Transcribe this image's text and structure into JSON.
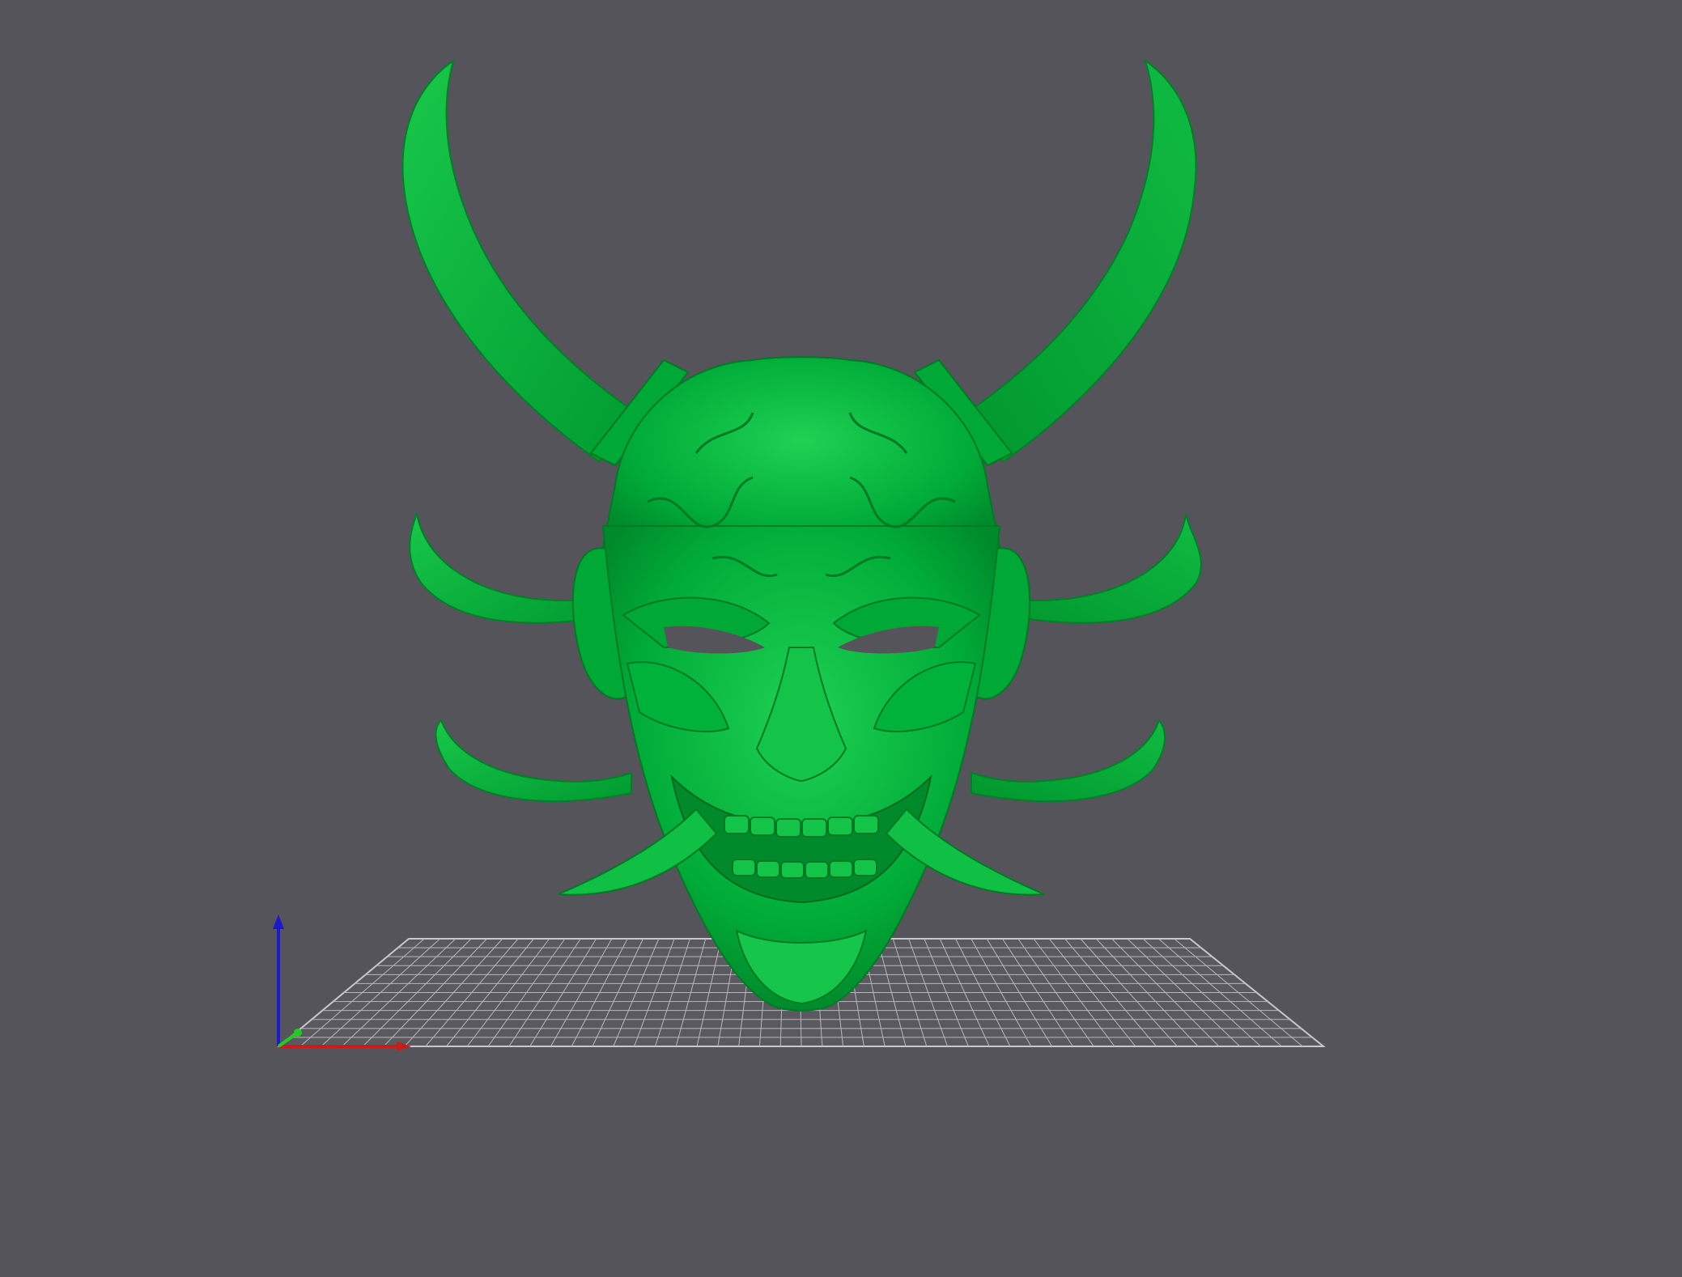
{
  "viewport": {
    "background_color": "#55545a"
  },
  "model": {
    "color": "#00b03a",
    "highlight_color": "#22d255",
    "shadow_color": "#007a24",
    "type": "oni-mask"
  },
  "build_plate": {
    "line_color": "#b8b8bc",
    "grid_on": true
  },
  "axes": {
    "z_color": "#1a1acc",
    "x_color": "#cc1a1a",
    "y_color": "#22cc22"
  }
}
